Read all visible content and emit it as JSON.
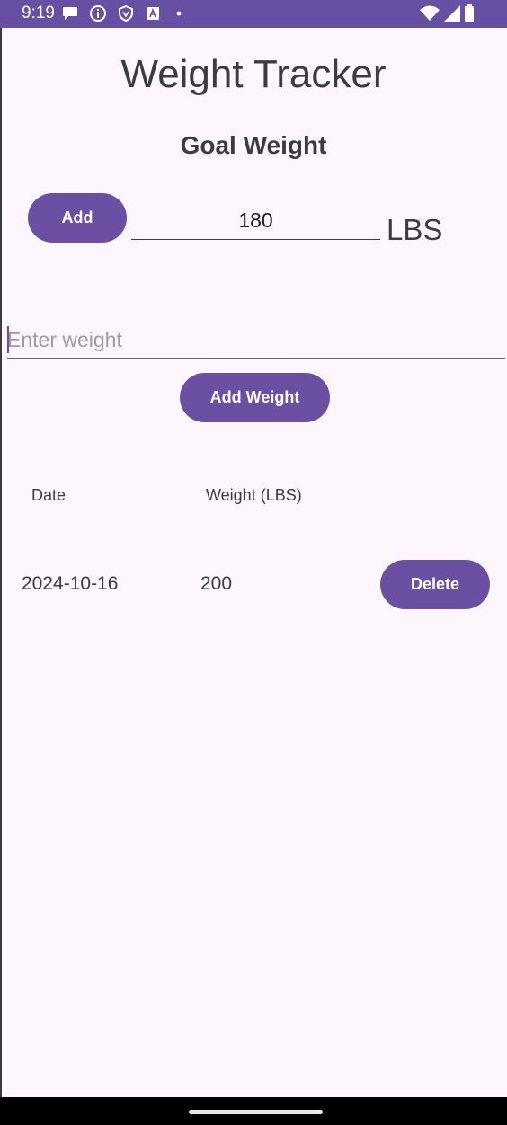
{
  "status_bar": {
    "time": "9:19",
    "icons": [
      "chat-bubble-icon",
      "info-icon",
      "shield-icon",
      "a-box-icon",
      "dot-icon",
      "wifi-icon",
      "signal-icon",
      "battery-icon"
    ],
    "color": "#6750a4"
  },
  "header": {
    "title": "Weight Tracker",
    "subtitle": "Goal Weight"
  },
  "goal": {
    "add_label": "Add",
    "value": "180",
    "unit": "LBS"
  },
  "entry": {
    "placeholder": "Enter weight",
    "value": "",
    "add_weight_label": "Add Weight"
  },
  "table": {
    "columns": [
      "Date",
      "Weight (LBS)"
    ],
    "rows": [
      {
        "date": "2024-10-16",
        "weight": "200",
        "delete_label": "Delete"
      }
    ]
  },
  "colors": {
    "accent": "#6a4fa3",
    "background": "#fdf7fd",
    "text": "#3d3a40"
  }
}
